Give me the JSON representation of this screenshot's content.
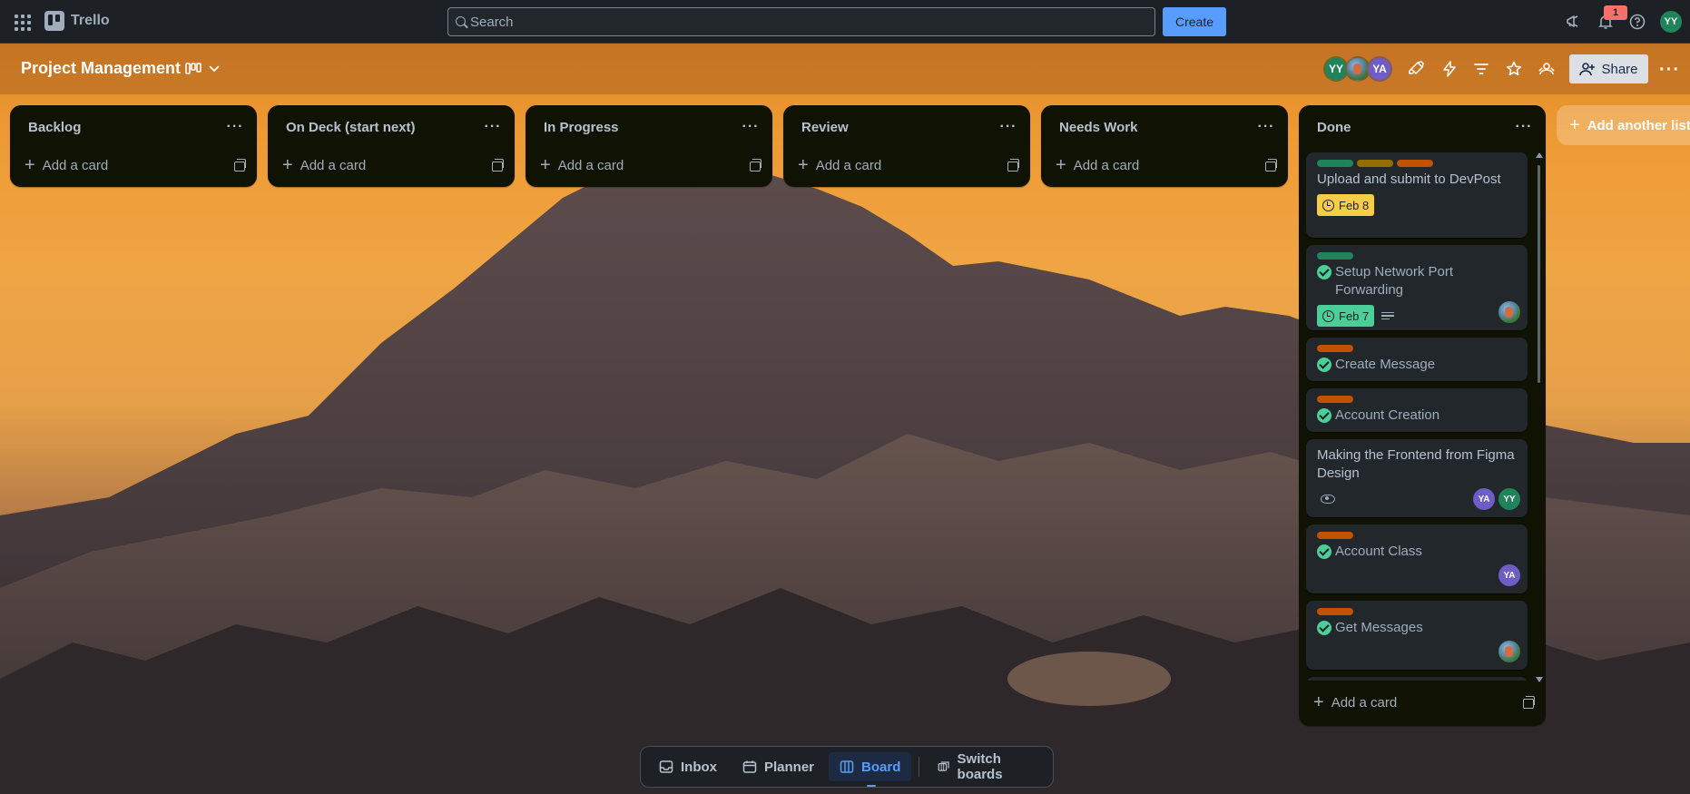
{
  "nav": {
    "app_name": "Trello",
    "search_placeholder": "Search",
    "create_label": "Create",
    "notification_count": "1",
    "user_initials": "YY"
  },
  "board": {
    "title": "Project Management",
    "members": [
      {
        "initials": "YY",
        "color": "#1f845a"
      },
      {
        "initials": "",
        "color": "#5b87a8",
        "photo": true
      },
      {
        "initials": "YA",
        "color": "#6e5dc6"
      }
    ],
    "share_label": "Share",
    "add_list_label": "Add another list"
  },
  "lists": [
    {
      "name": "Backlog",
      "add_card": "Add a card"
    },
    {
      "name": "On Deck (start next)",
      "add_card": "Add a card"
    },
    {
      "name": "In Progress",
      "add_card": "Add a card"
    },
    {
      "name": "Review",
      "add_card": "Add a card"
    },
    {
      "name": "Needs Work",
      "add_card": "Add a card"
    }
  ],
  "done_list": {
    "name": "Done",
    "add_card": "Add a card",
    "cards": [
      {
        "title": "Upload and submit to DevPost",
        "labels": [
          "#1f845a",
          "#946f00",
          "#c25100"
        ],
        "due": "Feb 8",
        "due_color": "yellow",
        "complete": false
      },
      {
        "title": "Setup Network Port Forwarding",
        "labels": [
          "#1f845a"
        ],
        "due": "Feb 7",
        "due_color": "green",
        "complete": true,
        "description": true,
        "members": [
          "photo"
        ]
      },
      {
        "title": "Create Message",
        "labels": [
          "#c25100"
        ],
        "complete": true
      },
      {
        "title": "Account Creation",
        "labels": [
          "#c25100"
        ],
        "complete": true
      },
      {
        "title": "Making the Frontend from Figma Design",
        "labels": [],
        "complete": false,
        "watching": true,
        "members": [
          "YA",
          "YY"
        ]
      },
      {
        "title": "Account Class",
        "labels": [
          "#c25100"
        ],
        "complete": true,
        "members": [
          "YA"
        ]
      },
      {
        "title": "Get Messages",
        "labels": [
          "#c25100"
        ],
        "complete": true,
        "members": [
          "photo"
        ]
      }
    ]
  },
  "switcher": {
    "inbox": "Inbox",
    "planner": "Planner",
    "board": "Board",
    "switch_boards": "Switch boards"
  }
}
